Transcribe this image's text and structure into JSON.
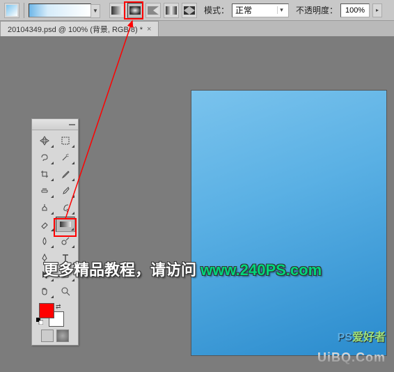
{
  "topbar": {
    "mode_label": "模式：",
    "mode_value": "正常",
    "opacity_label": "不透明度：",
    "opacity_value": "100%"
  },
  "tab": {
    "title": "20104349.psd @ 100% (背景, RGB/8) *"
  },
  "colors": {
    "foreground": "#ff0000",
    "background": "#ffffff"
  },
  "watermark": {
    "text": "更多精品教程，请访问 ",
    "url": "www.240PS.com",
    "logo1_a": "PS",
    "logo1_b": "爱好者",
    "logo2": "UiBQ.Com"
  },
  "chart_data": null
}
